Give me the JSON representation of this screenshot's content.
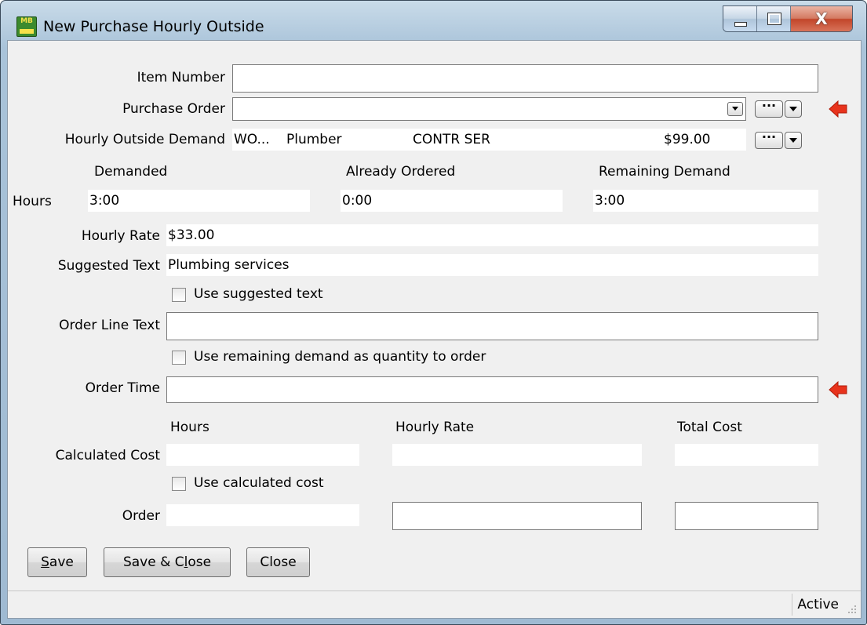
{
  "window": {
    "title": "New Purchase Hourly Outside",
    "icon": "mb-app-icon",
    "app_icon_text": "MB",
    "close_glyph": "X"
  },
  "form": {
    "item_number": {
      "label": "Item Number",
      "value": ""
    },
    "purchase_order": {
      "label": "Purchase Order",
      "value": ""
    },
    "hourly_outside_demand": {
      "label": "Hourly Outside Demand",
      "wo": "WO...",
      "trade": "Plumber",
      "category": "CONTR SER",
      "amount": "$99.00"
    },
    "demand_headers": {
      "demanded": "Demanded",
      "already_ordered": "Already Ordered",
      "remaining": "Remaining Demand"
    },
    "hours": {
      "label": "Hours",
      "demanded": "3:00",
      "already_ordered": "0:00",
      "remaining": "3:00"
    },
    "hourly_rate": {
      "label": "Hourly Rate",
      "value": "$33.00"
    },
    "suggested_text": {
      "label": "Suggested Text",
      "value": "Plumbing services"
    },
    "use_suggested_text": {
      "label": "Use suggested text",
      "checked": false
    },
    "order_line_text": {
      "label": "Order Line Text",
      "value": ""
    },
    "use_remaining_demand": {
      "label": "Use remaining demand as quantity to order",
      "checked": false
    },
    "order_time": {
      "label": "Order Time",
      "value": ""
    },
    "cost_headers": {
      "hours": "Hours",
      "hourly_rate": "Hourly Rate",
      "total_cost": "Total Cost"
    },
    "calculated_cost": {
      "label": "Calculated Cost",
      "hours": "",
      "hourly_rate": "",
      "total_cost": ""
    },
    "use_calculated_cost": {
      "label": "Use calculated cost",
      "checked": false
    },
    "order": {
      "label": "Order",
      "hours": "",
      "hourly_rate": "",
      "total_cost": ""
    }
  },
  "buttons": {
    "save": {
      "mnemonic": "S",
      "rest": "ave"
    },
    "save_close": {
      "before": "Save & C",
      "mnemonic": "l",
      "after": "ose"
    },
    "close": "Close",
    "ellipsis": "···"
  },
  "status": {
    "text": "Active"
  },
  "colors": {
    "required_arrow": "#e8331c",
    "title_gradient": "#a9c3d9",
    "client_bg": "#f0f0f0"
  }
}
